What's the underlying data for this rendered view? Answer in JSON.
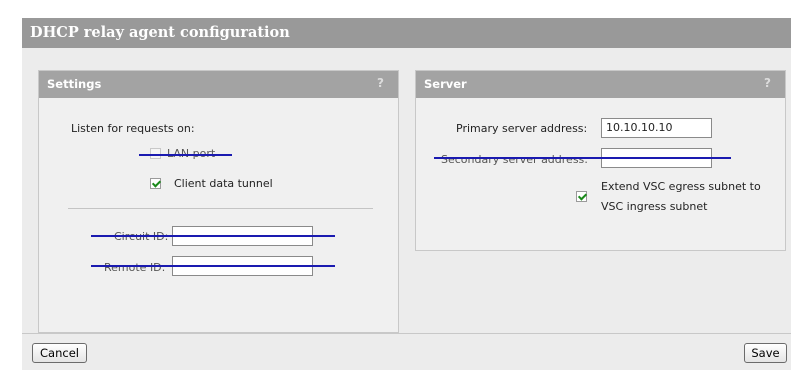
{
  "page": {
    "title": "DHCP relay agent configuration"
  },
  "settings": {
    "header": "Settings",
    "help": "?",
    "listen_label": "Listen for requests on:",
    "lan_port_label": "LAN port",
    "lan_port_checked": false,
    "client_tunnel_label": "Client data tunnel",
    "client_tunnel_checked": true,
    "circuit_id_label": "Circuit ID:",
    "circuit_id_value": "",
    "remote_id_label": "Remote ID:",
    "remote_id_value": ""
  },
  "server": {
    "header": "Server",
    "help": "?",
    "primary_label": "Primary server address:",
    "primary_value": "10.10.10.10",
    "secondary_label": "Secondary server address:",
    "secondary_value": "",
    "extend_label_line1": "Extend VSC egress subnet to",
    "extend_label_line2": "VSC ingress subnet",
    "extend_checked": true
  },
  "footer": {
    "cancel_label": "Cancel",
    "save_label": "Save"
  },
  "colors": {
    "title_bar": "#999999",
    "panel_header": "#a3a3a3",
    "strike": "#1a1ab0",
    "check": "#1a8a1a"
  }
}
